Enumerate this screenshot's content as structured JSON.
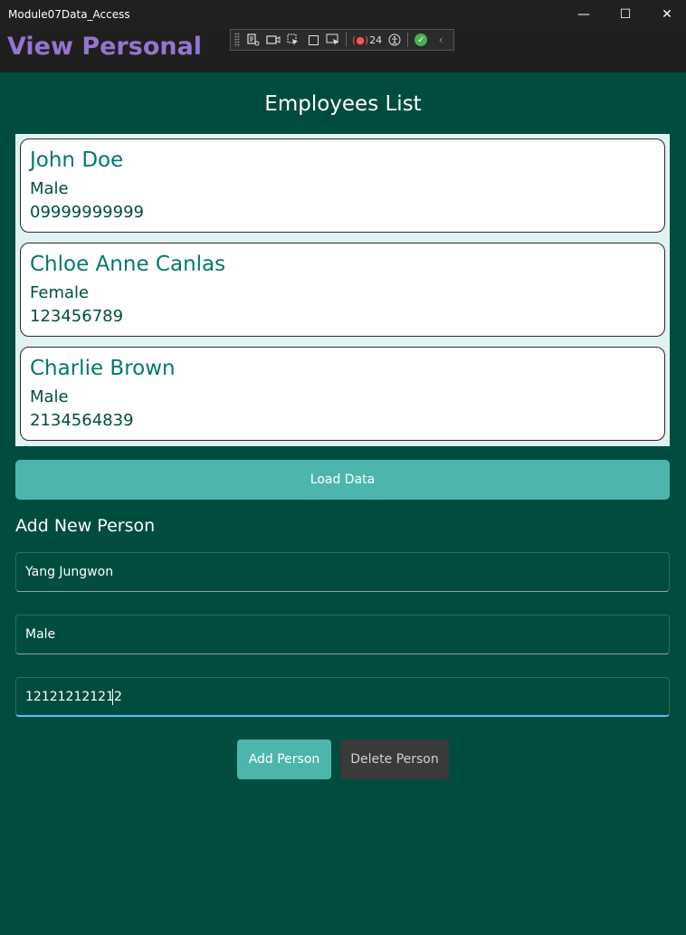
{
  "window": {
    "title": "Module07Data_Access",
    "minimize_glyph": "—",
    "maximize_glyph": "☐",
    "close_glyph": "✕"
  },
  "header": {
    "title": "View Personal"
  },
  "debug_toolbar": {
    "binding_failures_count": "24",
    "collapse_glyph": "‹"
  },
  "employees": {
    "title": "Employees List",
    "items": [
      {
        "name": "John Doe",
        "gender": "Male",
        "phone": "09999999999"
      },
      {
        "name": "Chloe Anne Canlas",
        "gender": "Female",
        "phone": "123456789"
      },
      {
        "name": "Charlie Brown",
        "gender": "Male",
        "phone": "2134564839"
      }
    ]
  },
  "load_button": {
    "label": "Load Data"
  },
  "add_form": {
    "title": "Add New Person",
    "name_value": "Yang Jungwon",
    "gender_value": "Male",
    "phone_value": "121212121212"
  },
  "actions": {
    "add_label": "Add Person",
    "delete_label": "Delete Person"
  },
  "colors": {
    "background": "#004d40",
    "accent": "#4db6ac",
    "header_title": "#9575cd",
    "name_text": "#00796b"
  }
}
